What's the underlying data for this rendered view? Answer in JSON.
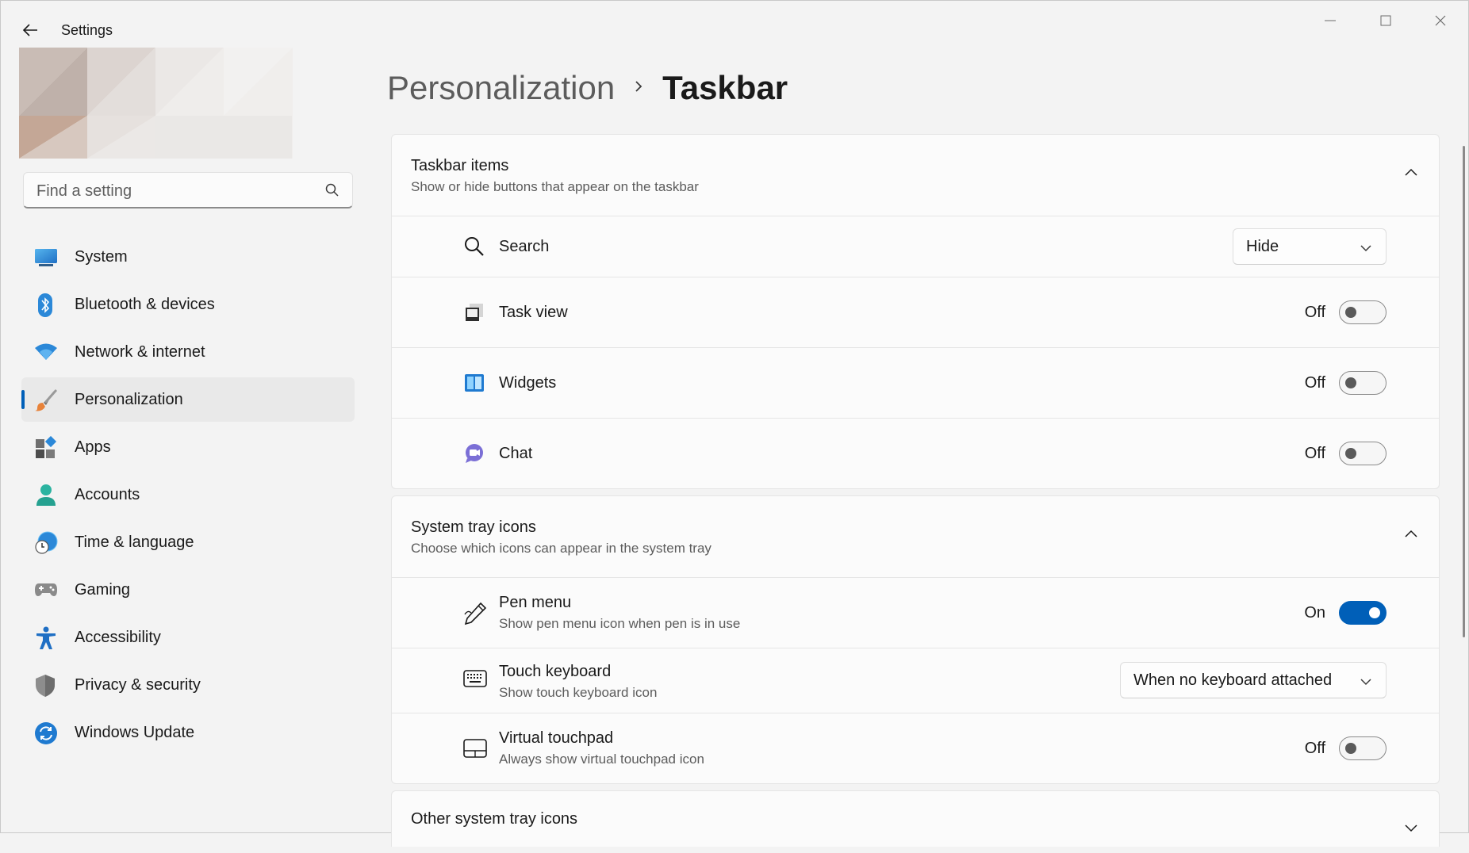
{
  "window": {
    "app_title": "Settings"
  },
  "search": {
    "placeholder": "Find a setting"
  },
  "sidebar": {
    "items": [
      {
        "label": "System",
        "icon": "monitor-icon"
      },
      {
        "label": "Bluetooth & devices",
        "icon": "bluetooth-icon"
      },
      {
        "label": "Network & internet",
        "icon": "wifi-icon"
      },
      {
        "label": "Personalization",
        "icon": "paintbrush-icon",
        "active": true
      },
      {
        "label": "Apps",
        "icon": "apps-icon"
      },
      {
        "label": "Accounts",
        "icon": "person-icon"
      },
      {
        "label": "Time & language",
        "icon": "globe-clock-icon"
      },
      {
        "label": "Gaming",
        "icon": "gamepad-icon"
      },
      {
        "label": "Accessibility",
        "icon": "accessibility-icon"
      },
      {
        "label": "Privacy & security",
        "icon": "shield-icon"
      },
      {
        "label": "Windows Update",
        "icon": "update-icon"
      }
    ]
  },
  "breadcrumb": {
    "parent": "Personalization",
    "current": "Taskbar"
  },
  "taskbar_items": {
    "title": "Taskbar items",
    "subtitle": "Show or hide buttons that appear on the taskbar",
    "rows": [
      {
        "label": "Search",
        "control": "dropdown",
        "value": "Hide"
      },
      {
        "label": "Task view",
        "control": "toggle",
        "state": "Off"
      },
      {
        "label": "Widgets",
        "control": "toggle",
        "state": "Off"
      },
      {
        "label": "Chat",
        "control": "toggle",
        "state": "Off"
      }
    ]
  },
  "system_tray": {
    "title": "System tray icons",
    "subtitle": "Choose which icons can appear in the system tray",
    "rows": [
      {
        "label": "Pen menu",
        "sub": "Show pen menu icon when pen is in use",
        "control": "toggle",
        "state": "On"
      },
      {
        "label": "Touch keyboard",
        "sub": "Show touch keyboard icon",
        "control": "dropdown",
        "value": "When no keyboard attached"
      },
      {
        "label": "Virtual touchpad",
        "sub": "Always show virtual touchpad icon",
        "control": "toggle",
        "state": "Off"
      }
    ]
  },
  "other_tray": {
    "title": "Other system tray icons"
  },
  "colors": {
    "accent": "#005fb8",
    "background": "#f3f3f3",
    "card": "#fbfbfb"
  }
}
